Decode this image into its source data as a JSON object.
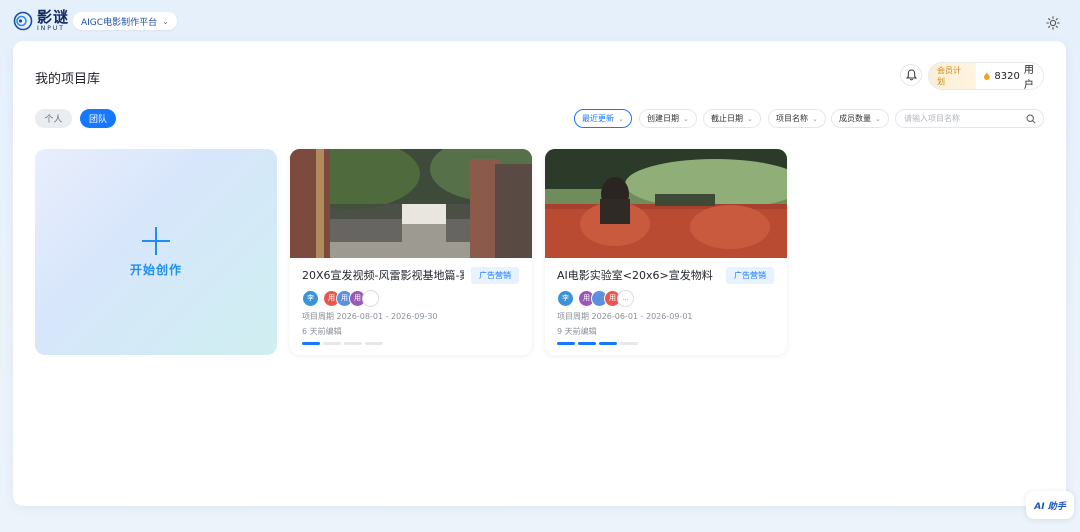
{
  "header": {
    "logo_cn": "影谜",
    "logo_en": "INPUT",
    "platform": "AIGC电影制作平台"
  },
  "main": {
    "title": "我的项目库",
    "vip_label": "会员计划",
    "points": "8320",
    "user_label": "用户",
    "scope_tabs": [
      "个人",
      "团队"
    ],
    "active_scope": "团队",
    "filters": [
      {
        "label": "最近更新",
        "active": true
      },
      {
        "label": "创建日期",
        "active": false
      },
      {
        "label": "截止日期",
        "active": false
      },
      {
        "label": "项目名称",
        "active": false
      },
      {
        "label": "成员数量",
        "active": false
      }
    ],
    "search_placeholder": "请输入项目名称",
    "create_label": "开始创作"
  },
  "projects": [
    {
      "title": "20X6宣发视频-风雷影视基地篇-案...",
      "tag": "广告营销",
      "owner_initial": "李",
      "members": [
        "用",
        "用",
        "用",
        ""
      ],
      "period": "项目周期 2026-08-01 - 2026-09-30",
      "edited": "6 天前编辑",
      "progress_steps_done": 1,
      "progress_steps_total": 4
    },
    {
      "title": "AI电影实验室<20x6>宣发物料",
      "tag": "广告营销",
      "owner_initial": "李",
      "members": [
        "用",
        "",
        "用",
        "..."
      ],
      "period": "项目周期 2026-06-01 - 2026-09-01",
      "edited": "9 天前编辑",
      "progress_steps_done": 3,
      "progress_steps_total": 4
    }
  ],
  "ai_helper": "AI 助手",
  "colors": {
    "accent": "#1677ff",
    "vip": "#c98a12"
  }
}
